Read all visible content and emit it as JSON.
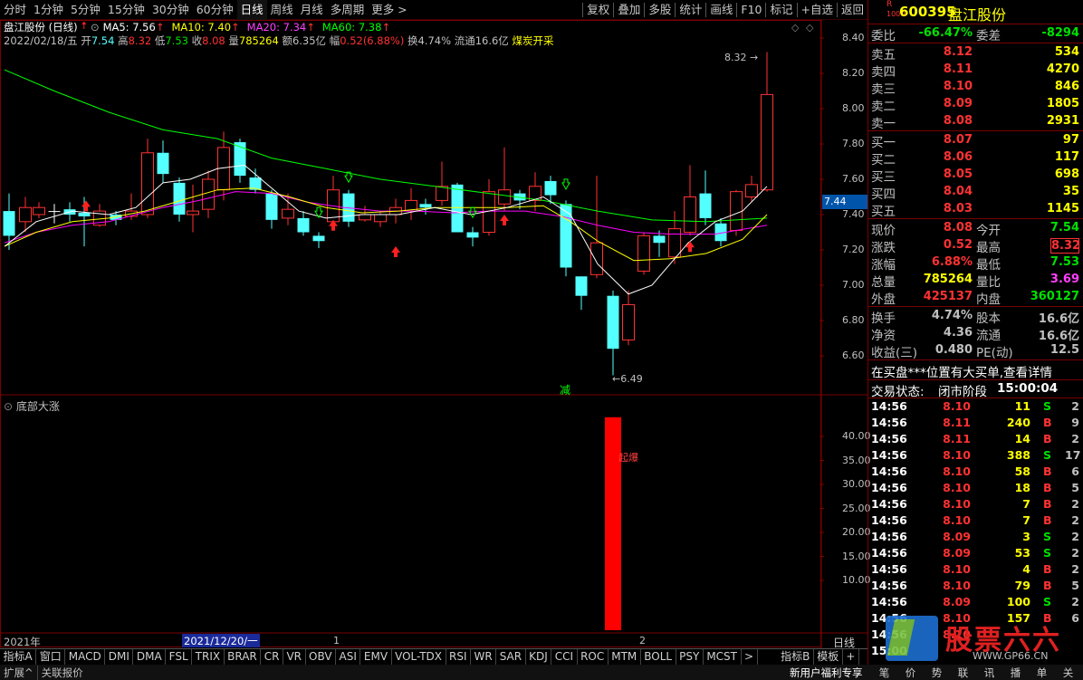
{
  "toolbar": {
    "left": [
      "分时",
      "1分钟",
      "5分钟",
      "15分钟",
      "30分钟",
      "60分钟",
      "日线",
      "周线",
      "月线",
      "多周期",
      "更多 >"
    ],
    "active": "日线",
    "right": [
      "复权",
      "叠加",
      "多股",
      "统计",
      "画线",
      "F10",
      "标记",
      "+自选",
      "返回"
    ]
  },
  "info": {
    "name": "盘江股份 (日线)",
    "ma5": "MA5: 7.56",
    "ma10": "MA10: 7.40",
    "ma20": "MA20: 7.34",
    "ma60": "MA60: 7.38",
    "date": "2022/02/18/五",
    "open_l": "开",
    "open_v": "7.54",
    "high_l": "高",
    "high_v": "8.32",
    "low_l": "低",
    "low_v": "7.53",
    "close_l": "收",
    "close_v": "8.08",
    "vol_l": "量",
    "vol_v": "785264",
    "amt": "额6.35亿",
    "amp_l": "幅",
    "amp_v": "0.52(6.88%)",
    "turn": "换4.74%",
    "float": "流通16.6亿",
    "concept": "煤炭开采"
  },
  "main_chart": {
    "y_labels": [
      "8.40",
      "8.20",
      "8.00",
      "7.80",
      "7.60",
      "7.40",
      "7.20",
      "7.00",
      "6.80",
      "6.60"
    ],
    "current_price_tag": "7.44",
    "max_note": "8.32",
    "min_note": "6.49",
    "signal_text": "减"
  },
  "sub_chart": {
    "title": "底部大涨",
    "y_labels": [
      "40.00",
      "35.00",
      "30.00",
      "25.00",
      "20.00",
      "15.00",
      "10.00"
    ],
    "bar_label": "起爆"
  },
  "date_axis": {
    "year": "2021年",
    "cursor_date": "2021/12/20/一",
    "mark1": "1",
    "mark2": "2",
    "period": "日线"
  },
  "bottom_tabs": [
    "指标A",
    "窗口",
    "MACD",
    "DMI",
    "DMA",
    "FSL",
    "TRIX",
    "BRAR",
    "CR",
    "VR",
    "OBV",
    "ASI",
    "EMV",
    "VOL-TDX",
    "RSI",
    "WR",
    "SAR",
    "KDJ",
    "CCI",
    "ROC",
    "MTM",
    "BOLL",
    "PSY",
    "MCST",
    ">",
    "指标B",
    "模板",
    "+"
  ],
  "status_bar": {
    "left": [
      "扩展^",
      "关联报价"
    ],
    "promo": "新用户福利专享",
    "tools": [
      "笔",
      "价",
      "势",
      "联",
      "讯",
      "播",
      "单",
      "关"
    ]
  },
  "quote": {
    "code": "600395",
    "name": "盘江股份",
    "r_mark": "R",
    "r_sub": "1000",
    "wb_l": "委比",
    "wb_v": "-66.47%",
    "wc_l": "委差",
    "wc_v": "-8294",
    "asks": [
      {
        "label": "卖五",
        "price": "8.12",
        "vol": "534"
      },
      {
        "label": "卖四",
        "price": "8.11",
        "vol": "4270"
      },
      {
        "label": "卖三",
        "price": "8.10",
        "vol": "846"
      },
      {
        "label": "卖二",
        "price": "8.09",
        "vol": "1805"
      },
      {
        "label": "卖一",
        "price": "8.08",
        "vol": "2931"
      }
    ],
    "bids": [
      {
        "label": "买一",
        "price": "8.07",
        "vol": "97"
      },
      {
        "label": "买二",
        "price": "8.06",
        "vol": "117"
      },
      {
        "label": "买三",
        "price": "8.05",
        "vol": "698"
      },
      {
        "label": "买四",
        "price": "8.04",
        "vol": "35"
      },
      {
        "label": "买五",
        "price": "8.03",
        "vol": "1145"
      }
    ],
    "stats": [
      {
        "l1": "现价",
        "v1": "8.08",
        "l2": "今开",
        "v2": "7.54"
      },
      {
        "l1": "涨跌",
        "v1": "0.52",
        "l2": "最高",
        "v2": "8.32"
      },
      {
        "l1": "涨幅",
        "v1": "6.88%",
        "l2": "最低",
        "v2": "7.53"
      },
      {
        "l1": "总量",
        "v1": "785264",
        "l2": "量比",
        "v2": "3.69"
      },
      {
        "l1": "外盘",
        "v1": "425137",
        "l2": "内盘",
        "v2": "360127"
      }
    ],
    "stats2": [
      {
        "l1": "换手",
        "v1": "4.74%",
        "l2": "股本",
        "v2": "16.6亿"
      },
      {
        "l1": "净资",
        "v1": "4.36",
        "l2": "流通",
        "v2": "16.6亿"
      },
      {
        "l1": "收益(三)",
        "v1": "0.480",
        "l2": "PE(动)",
        "v2": "12.5"
      }
    ],
    "notice": "在买盘***位置有大买单,查看详情",
    "trade_status_l": "交易状态:",
    "trade_status_v": "闭市阶段",
    "trade_time": "15:00:04",
    "ticks": [
      {
        "t": "14:56",
        "p": "8.10",
        "v": "11",
        "d": "S",
        "n": "2"
      },
      {
        "t": "14:56",
        "p": "8.11",
        "v": "240",
        "d": "B",
        "n": "9"
      },
      {
        "t": "14:56",
        "p": "8.11",
        "v": "14",
        "d": "B",
        "n": "2"
      },
      {
        "t": "14:56",
        "p": "8.10",
        "v": "388",
        "d": "S",
        "n": "17"
      },
      {
        "t": "14:56",
        "p": "8.10",
        "v": "58",
        "d": "B",
        "n": "6"
      },
      {
        "t": "14:56",
        "p": "8.10",
        "v": "18",
        "d": "B",
        "n": "5"
      },
      {
        "t": "14:56",
        "p": "8.10",
        "v": "7",
        "d": "B",
        "n": "2"
      },
      {
        "t": "14:56",
        "p": "8.10",
        "v": "7",
        "d": "B",
        "n": "2"
      },
      {
        "t": "14:56",
        "p": "8.09",
        "v": "3",
        "d": "S",
        "n": "2"
      },
      {
        "t": "14:56",
        "p": "8.09",
        "v": "53",
        "d": "S",
        "n": "2"
      },
      {
        "t": "14:56",
        "p": "8.10",
        "v": "4",
        "d": "B",
        "n": "2"
      },
      {
        "t": "14:56",
        "p": "8.10",
        "v": "79",
        "d": "B",
        "n": "5"
      },
      {
        "t": "14:56",
        "p": "8.09",
        "v": "100",
        "d": "S",
        "n": "2"
      },
      {
        "t": "14:56",
        "p": "8.10",
        "v": "157",
        "d": "B",
        "n": "6"
      },
      {
        "t": "14:56",
        "p": "8.10",
        "v": "",
        "d": "",
        "n": ""
      },
      {
        "t": "15:00",
        "p": "",
        "v": "",
        "d": "",
        "n": ""
      }
    ],
    "watermark": "股票六六",
    "watermark_sub": "WWW.GP66.CN"
  },
  "colors": {
    "up": "#ff3232",
    "down": "#54ffff",
    "flat": "#ffffff",
    "ma5": "#ffffff",
    "ma10": "#ffff00",
    "ma20": "#ff00ff",
    "ma60": "#00ff00"
  }
}
